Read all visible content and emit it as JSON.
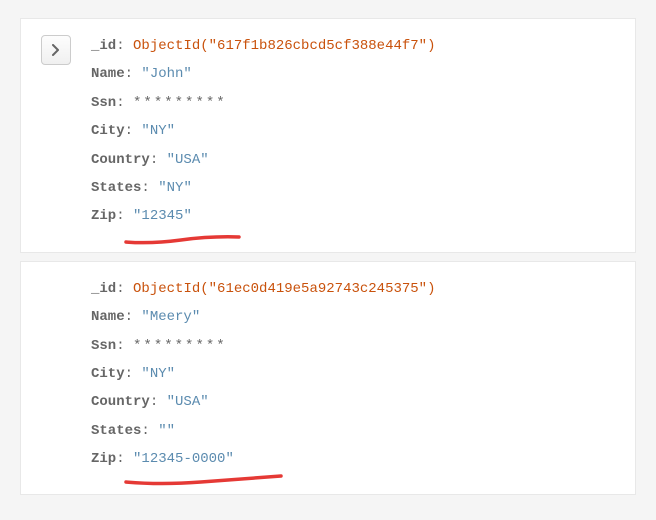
{
  "documents": [
    {
      "has_expand_button": true,
      "fields": {
        "_id_label": "_id",
        "_id_value": "ObjectId(\"617f1b826cbcd5cf388e44f7\")",
        "name_label": "Name",
        "name_value": "\"John\"",
        "ssn_label": "Ssn",
        "ssn_value": "*********",
        "city_label": "City",
        "city_value": "\"NY\"",
        "country_label": "Country",
        "country_value": "\"USA\"",
        "states_label": "States",
        "states_value": "\"NY\"",
        "zip_label": "Zip",
        "zip_value": "\"12345\""
      },
      "underline_width": 120
    },
    {
      "has_expand_button": false,
      "fields": {
        "_id_label": "_id",
        "_id_value": "ObjectId(\"61ec0d419e5a92743c245375\")",
        "name_label": "Name",
        "name_value": "\"Meery\"",
        "ssn_label": "Ssn",
        "ssn_value": "*********",
        "city_label": "City",
        "city_value": "\"NY\"",
        "country_label": "Country",
        "country_value": "\"USA\"",
        "states_label": "States",
        "states_value": "\"\"",
        "zip_label": "Zip",
        "zip_value": "\"12345-0000\""
      },
      "underline_width": 160
    }
  ],
  "colors": {
    "objectid": "#c9520c",
    "string": "#5b8baf",
    "key": "#666",
    "underline": "#e53935"
  }
}
